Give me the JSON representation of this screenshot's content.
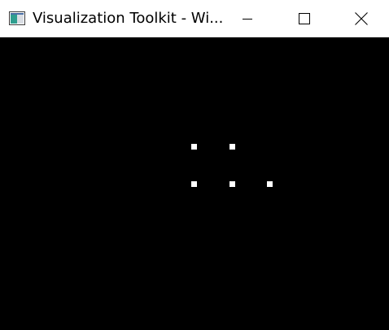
{
  "window": {
    "title": "Visualization Toolkit - Wi...",
    "icon": "vtk-app-icon",
    "controls": {
      "minimize_icon": "minimize-icon",
      "maximize_icon": "maximize-icon",
      "close_icon": "close-icon"
    }
  },
  "viewport": {
    "background_color": "#000000",
    "point_color": "#ffffff",
    "point_count": 5
  }
}
